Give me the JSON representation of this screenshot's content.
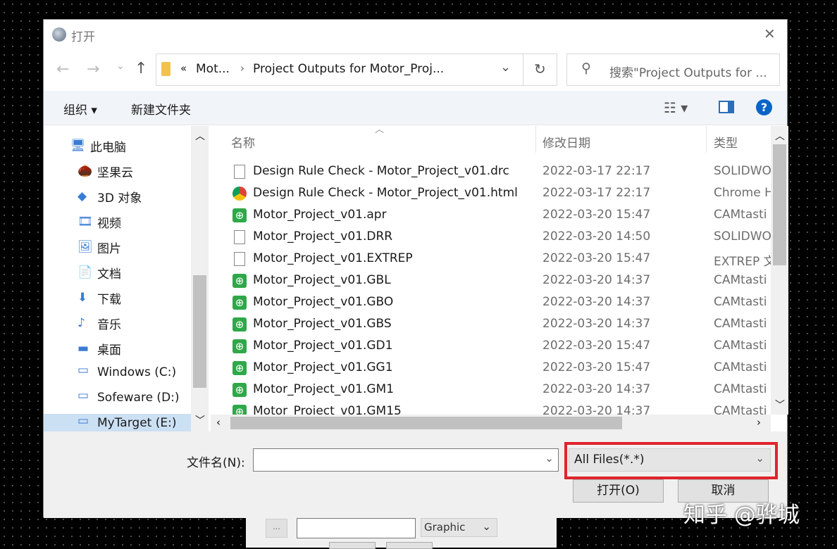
{
  "window": {
    "title": "打开",
    "close": "✕"
  },
  "nav": {
    "back": "←",
    "forward": "→",
    "recent": "⌄",
    "up": "↑",
    "path_overflow": "«",
    "path": [
      "Mot...",
      "Project Outputs for Motor_Proj..."
    ],
    "refresh": "↻",
    "search_placeholder": "搜索\"Project Outputs for ..."
  },
  "toolbar": {
    "organize": "组织 ▾",
    "new_folder": "新建文件夹",
    "help": "?"
  },
  "sidebar": {
    "items": [
      {
        "label": "此电脑",
        "icon": "computer-icon",
        "glyph": "🖥"
      },
      {
        "label": "坚果云",
        "icon": "nutstore-icon",
        "glyph": "🌰"
      },
      {
        "label": "3D 对象",
        "icon": "3d-objects-icon",
        "glyph": "◆"
      },
      {
        "label": "视频",
        "icon": "video-icon",
        "glyph": "🎞"
      },
      {
        "label": "图片",
        "icon": "pictures-icon",
        "glyph": "🖼"
      },
      {
        "label": "文档",
        "icon": "documents-icon",
        "glyph": "📄"
      },
      {
        "label": "下载",
        "icon": "download-icon",
        "glyph": "⬇"
      },
      {
        "label": "音乐",
        "icon": "music-icon",
        "glyph": "♪"
      },
      {
        "label": "桌面",
        "icon": "desktop-icon",
        "glyph": "▬"
      },
      {
        "label": "Windows (C:)",
        "icon": "drive-icon",
        "glyph": "▭"
      },
      {
        "label": "Sofeware (D:)",
        "icon": "drive-icon",
        "glyph": "▭"
      },
      {
        "label": "MyTarget (E:)",
        "icon": "drive-icon",
        "glyph": "▭"
      }
    ]
  },
  "list": {
    "columns": [
      "名称",
      "修改日期",
      "类型"
    ],
    "rows": [
      {
        "name": "Design Rule Check - Motor_Project_v01.drc",
        "date": "2022-03-17 22:17",
        "type": "SOLIDWO",
        "icon": "doc"
      },
      {
        "name": "Design Rule Check - Motor_Project_v01.html",
        "date": "2022-03-17 22:17",
        "type": "Chrome H",
        "icon": "chrome"
      },
      {
        "name": "Motor_Project_v01.apr",
        "date": "2022-03-20 15:47",
        "type": "CAMtasti",
        "icon": "cam"
      },
      {
        "name": "Motor_Project_v01.DRR",
        "date": "2022-03-20 14:50",
        "type": "SOLIDWO",
        "icon": "doc"
      },
      {
        "name": "Motor_Project_v01.EXTREP",
        "date": "2022-03-20 15:47",
        "type": "EXTREP 文",
        "icon": "blank"
      },
      {
        "name": "Motor_Project_v01.GBL",
        "date": "2022-03-20 14:37",
        "type": "CAMtasti",
        "icon": "cam"
      },
      {
        "name": "Motor_Project_v01.GBO",
        "date": "2022-03-20 14:37",
        "type": "CAMtasti",
        "icon": "cam"
      },
      {
        "name": "Motor_Project_v01.GBS",
        "date": "2022-03-20 14:37",
        "type": "CAMtasti",
        "icon": "cam"
      },
      {
        "name": "Motor_Project_v01.GD1",
        "date": "2022-03-20 15:47",
        "type": "CAMtasti",
        "icon": "cam"
      },
      {
        "name": "Motor_Project_v01.GG1",
        "date": "2022-03-20 15:47",
        "type": "CAMtasti",
        "icon": "cam"
      },
      {
        "name": "Motor_Project_v01.GM1",
        "date": "2022-03-20 14:37",
        "type": "CAMtasti",
        "icon": "cam"
      },
      {
        "name": "Motor_Project_v01.GM15",
        "date": "2022-03-20 14:37",
        "type": "CAMtasti",
        "icon": "cam"
      }
    ]
  },
  "bottom": {
    "filename_label": "文件名(N):",
    "filename_value": "",
    "filter": "All Files(*.*)",
    "open": "打开(O)",
    "cancel": "取消"
  },
  "behind": {
    "browse": "...",
    "type": "Graphic"
  },
  "watermark": "知乎 @骅城",
  "colors": {
    "highlight": "#e0242c",
    "accent": "#0a64c8"
  }
}
